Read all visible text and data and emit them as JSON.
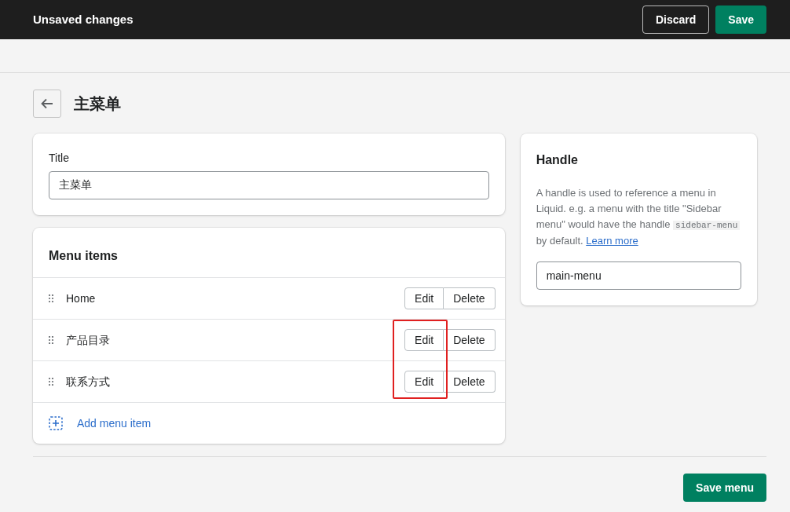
{
  "top_bar": {
    "title": "Unsaved changes",
    "discard": "Discard",
    "save": "Save"
  },
  "page_title": "主菜单",
  "title_card": {
    "label": "Title",
    "value": "主菜单"
  },
  "menu_card": {
    "heading": "Menu items",
    "items": [
      {
        "label": "Home",
        "edit": "Edit",
        "delete": "Delete"
      },
      {
        "label": "产品目录",
        "edit": "Edit",
        "delete": "Delete"
      },
      {
        "label": "联系方式",
        "edit": "Edit",
        "delete": "Delete"
      }
    ],
    "add": "Add menu item"
  },
  "handle_card": {
    "heading": "Handle",
    "text_before": "A handle is used to reference a menu in Liquid. e.g. a menu with the title \"Sidebar menu\" would have the handle ",
    "code": "sidebar-menu",
    "text_after": " by default. ",
    "link": "Learn more",
    "value": "main-menu"
  },
  "save_menu": "Save menu"
}
